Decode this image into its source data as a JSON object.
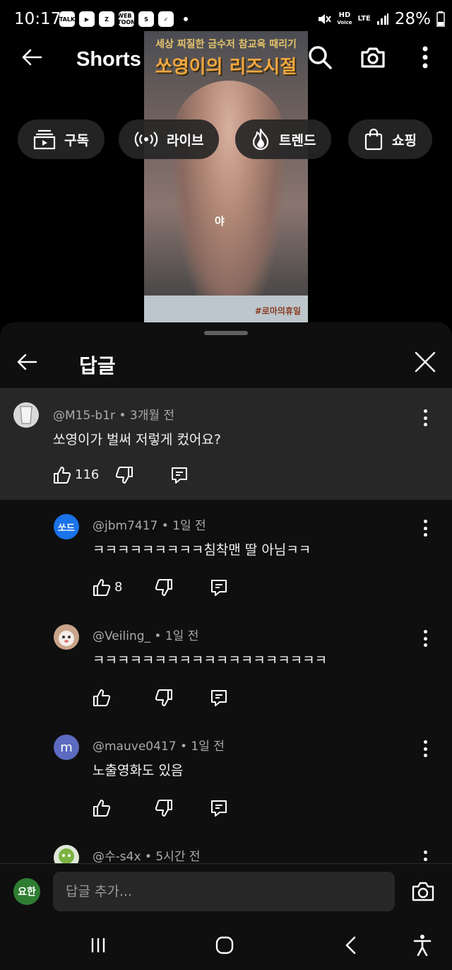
{
  "status_bar": {
    "time": "10:17",
    "notifications": [
      "TALK",
      "▶",
      "Z",
      "WEB TOON",
      "S",
      "✓"
    ],
    "hd_label": "HD",
    "voice_label": "Voice",
    "lte_label": "LTE",
    "battery": "28%"
  },
  "video": {
    "caption_top": "세상 찌질한 금수저 참교육 때리기",
    "caption_main": "쏘영이의 리즈시절",
    "overlay_text": "야",
    "hashtag": "#로마의휴일"
  },
  "header": {
    "title": "Shorts"
  },
  "chips": [
    {
      "label": "구독",
      "icon": "subscriptions-icon"
    },
    {
      "label": "라이브",
      "icon": "live-icon"
    },
    {
      "label": "트렌드",
      "icon": "trending-icon"
    },
    {
      "label": "쇼핑",
      "icon": "shopping-bag-icon"
    }
  ],
  "panel": {
    "title": "답글"
  },
  "parent_comment": {
    "author": "@M15-b1r",
    "time": "3개월 전",
    "text": "쏘영이가 벌써 저렇게 컸어요?",
    "likes": "116"
  },
  "replies": [
    {
      "author": "@jbm7417",
      "time": "1일 전",
      "text": "ㅋㅋㅋㅋㅋㅋㅋㅋㅋ침착맨 딸 아님ㅋㅋ",
      "likes": "8",
      "avatar_text": "쏘드",
      "avatar_color": "#1a73e8"
    },
    {
      "author": "@Veiling_",
      "time": "1일 전",
      "text": "ㅋㅋㅋㅋㅋㅋㅋㅋㅋㅋㅋㅋㅋㅋㅋㅋㅋㅋㅋ",
      "likes": "",
      "avatar_text": "",
      "avatar_color": "#6b3a2e"
    },
    {
      "author": "@mauve0417",
      "time": "1일 전",
      "text": "노출영화도 있음",
      "likes": "",
      "avatar_text": "m",
      "avatar_color": "#5c6bc0"
    },
    {
      "author": "@수-s4x",
      "time": "5시간 전",
      "text": "",
      "likes": "",
      "avatar_text": "",
      "avatar_color": "#7cb342"
    }
  ],
  "input": {
    "placeholder": "답글 추가...",
    "user_avatar_text": "요한",
    "user_avatar_color": "#2e7d32"
  },
  "separator": "•"
}
